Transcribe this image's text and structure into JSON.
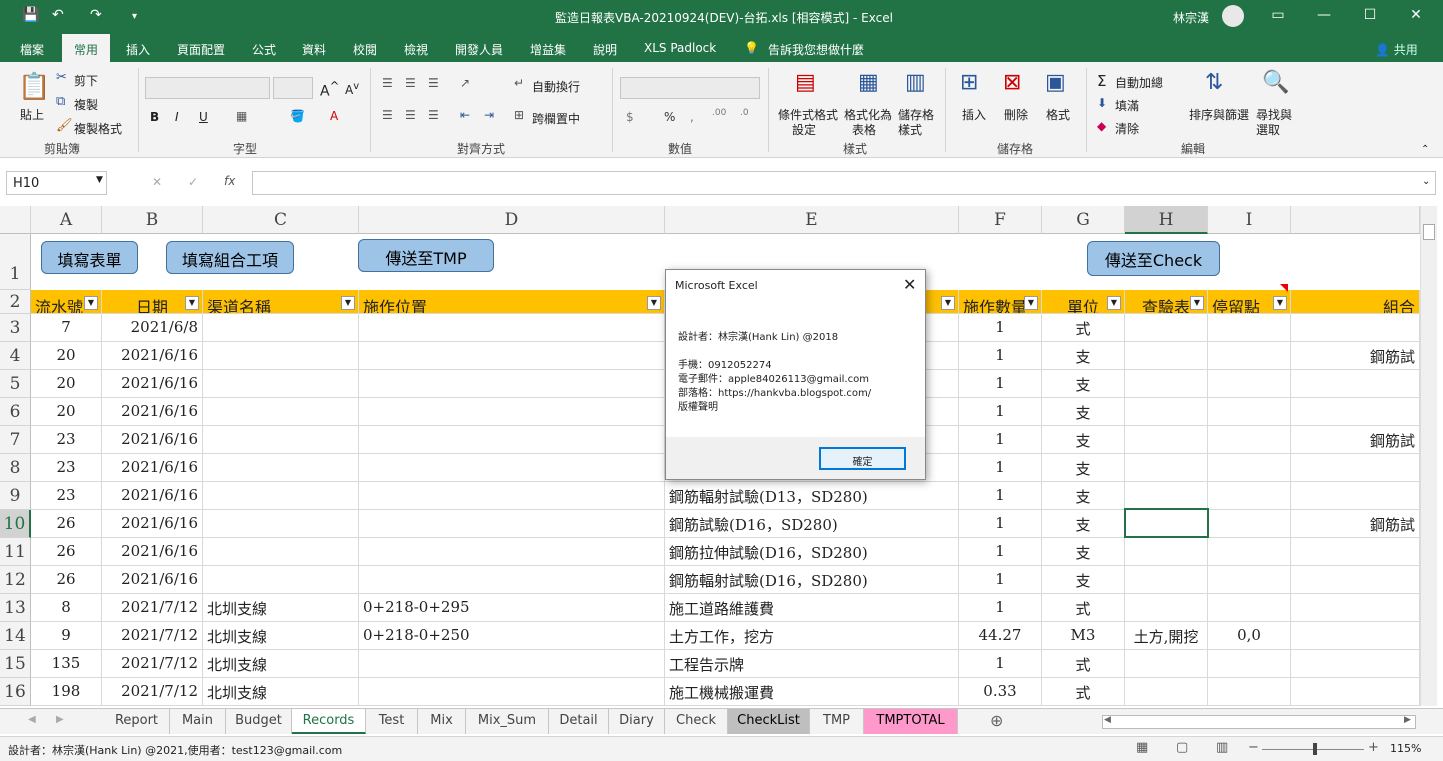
{
  "window": {
    "title": "監造日報表VBA-20210924(DEV)-台拓.xls [相容模式] - Excel",
    "user": "林宗漢"
  },
  "menu": [
    "檔案",
    "常用",
    "插入",
    "頁面配置",
    "公式",
    "資料",
    "校閱",
    "檢視",
    "開發人員",
    "增益集",
    "說明",
    "XLS Padlock",
    "告訴我您想做什麼"
  ],
  "share_label": "共用",
  "ribbon": {
    "clipboard": {
      "paste": "貼上",
      "cut": "剪下",
      "copy": "複製",
      "format_painter": "複製格式",
      "label": "剪貼簿"
    },
    "font": {
      "label": "字型",
      "bold": "B",
      "italic": "I",
      "underline": "U"
    },
    "align": {
      "wrap": "自動換行",
      "merge": "跨欄置中",
      "label": "對齊方式"
    },
    "number": {
      "label": "數值",
      "currency": "$",
      "percent": "%"
    },
    "styles": {
      "cond": "條件式格式",
      "cond2": "設定",
      "table": "格式化為",
      "table2": "表格",
      "cell": "儲存格",
      "cell2": "樣式",
      "label": "樣式"
    },
    "cells": {
      "insert": "插入",
      "delete": "刪除",
      "format": "格式",
      "label": "儲存格"
    },
    "edit": {
      "autosum": "自動加總",
      "fill": "填滿",
      "clear": "清除",
      "sort": "排序與篩選",
      "find": "尋找與",
      "find2": "選取",
      "label": "編輯"
    }
  },
  "formula": {
    "namebox": "H10",
    "fx": "fx",
    "cancel": "✕",
    "enter": "✓"
  },
  "columns": [
    "A",
    "B",
    "C",
    "D",
    "E",
    "F",
    "G",
    "H",
    "I"
  ],
  "buttons": {
    "fill_form": "填寫表單",
    "fill_combo": "填寫組合工項",
    "send_tmp": "傳送至TMP",
    "send_check": "傳送至Check"
  },
  "headers": {
    "a": "流水號",
    "b": "日期",
    "c": "渠道名稱",
    "d": "施作位置",
    "f": "施作數量",
    "g": "單位",
    "h": "查驗表",
    "i": "停留點",
    "j": "組合"
  },
  "rows": [
    {
      "n": "3",
      "a": "7",
      "b": "2021/6/8",
      "c": "",
      "d": "",
      "e": "",
      "f": "1",
      "g": "式",
      "h": "",
      "i": "",
      "j": ""
    },
    {
      "n": "4",
      "a": "20",
      "b": "2021/6/16",
      "c": "",
      "d": "",
      "e": "",
      "f": "1",
      "g": "支",
      "h": "",
      "i": "",
      "j": "鋼筋試"
    },
    {
      "n": "5",
      "a": "20",
      "b": "2021/6/16",
      "c": "",
      "d": "",
      "e": "",
      "f": "1",
      "g": "支",
      "h": "",
      "i": "",
      "j": ""
    },
    {
      "n": "6",
      "a": "20",
      "b": "2021/6/16",
      "c": "",
      "d": "",
      "e": "",
      "f": "1",
      "g": "支",
      "h": "",
      "i": "",
      "j": ""
    },
    {
      "n": "7",
      "a": "23",
      "b": "2021/6/16",
      "c": "",
      "d": "",
      "e": "",
      "f": "1",
      "g": "支",
      "h": "",
      "i": "",
      "j": "鋼筋試"
    },
    {
      "n": "8",
      "a": "23",
      "b": "2021/6/16",
      "c": "",
      "d": "",
      "e": "",
      "f": "1",
      "g": "支",
      "h": "",
      "i": "",
      "j": ""
    },
    {
      "n": "9",
      "a": "23",
      "b": "2021/6/16",
      "c": "",
      "d": "",
      "e": "鋼筋輻射試驗(D13，SD280)",
      "f": "1",
      "g": "支",
      "h": "",
      "i": "",
      "j": ""
    },
    {
      "n": "10",
      "a": "26",
      "b": "2021/6/16",
      "c": "",
      "d": "",
      "e": "鋼筋試驗(D16，SD280)",
      "f": "1",
      "g": "支",
      "h": "",
      "i": "",
      "j": "鋼筋試"
    },
    {
      "n": "11",
      "a": "26",
      "b": "2021/6/16",
      "c": "",
      "d": "",
      "e": "鋼筋拉伸試驗(D16，SD280)",
      "f": "1",
      "g": "支",
      "h": "",
      "i": "",
      "j": ""
    },
    {
      "n": "12",
      "a": "26",
      "b": "2021/6/16",
      "c": "",
      "d": "",
      "e": "鋼筋輻射試驗(D16，SD280)",
      "f": "1",
      "g": "支",
      "h": "",
      "i": "",
      "j": ""
    },
    {
      "n": "13",
      "a": "8",
      "b": "2021/7/12",
      "c": "北圳支線",
      "d": "0+218-0+295",
      "e": "施工道路維護費",
      "f": "1",
      "g": "式",
      "h": "",
      "i": "",
      "j": ""
    },
    {
      "n": "14",
      "a": "9",
      "b": "2021/7/12",
      "c": "北圳支線",
      "d": "0+218-0+250",
      "e": "土方工作，挖方",
      "f": "44.27",
      "g": "M3",
      "h": "土方,開挖",
      "i": "0,0",
      "j": ""
    },
    {
      "n": "15",
      "a": "135",
      "b": "2021/7/12",
      "c": "北圳支線",
      "d": "",
      "e": "工程告示牌",
      "f": "1",
      "g": "式",
      "h": "",
      "i": "",
      "j": ""
    },
    {
      "n": "16",
      "a": "198",
      "b": "2021/7/12",
      "c": "北圳支線",
      "d": "",
      "e": "施工機械搬運費",
      "f": "0.33",
      "g": "式",
      "h": "",
      "i": "",
      "j": ""
    }
  ],
  "dialog": {
    "title": "Microsoft Excel",
    "line1": "設計者：林宗漢(Hank Lin) @2018",
    "line2": "手機：0912052274",
    "line3": "電子郵件：apple84026113@gmail.com",
    "line4": "部落格：https://hankvba.blogspot.com/",
    "line5": "版權聲明",
    "ok": "確定"
  },
  "tabs": [
    "Report",
    "Main",
    "Budget",
    "Records",
    "Test",
    "Mix",
    "Mix_Sum",
    "Detail",
    "Diary",
    "Check",
    "CheckList",
    "TMP",
    "TMPTOTAL"
  ],
  "active_tab": "Records",
  "status": {
    "text": "設計者：林宗漢(Hank Lin) @2021,使用者：test123@gmail.com",
    "zoom": "115%"
  },
  "colors": {
    "excel_green": "#217346",
    "header_fill": "#ffc000",
    "button_fill": "#9dc3e6",
    "tmptotal_tab": "#ff99cc"
  }
}
